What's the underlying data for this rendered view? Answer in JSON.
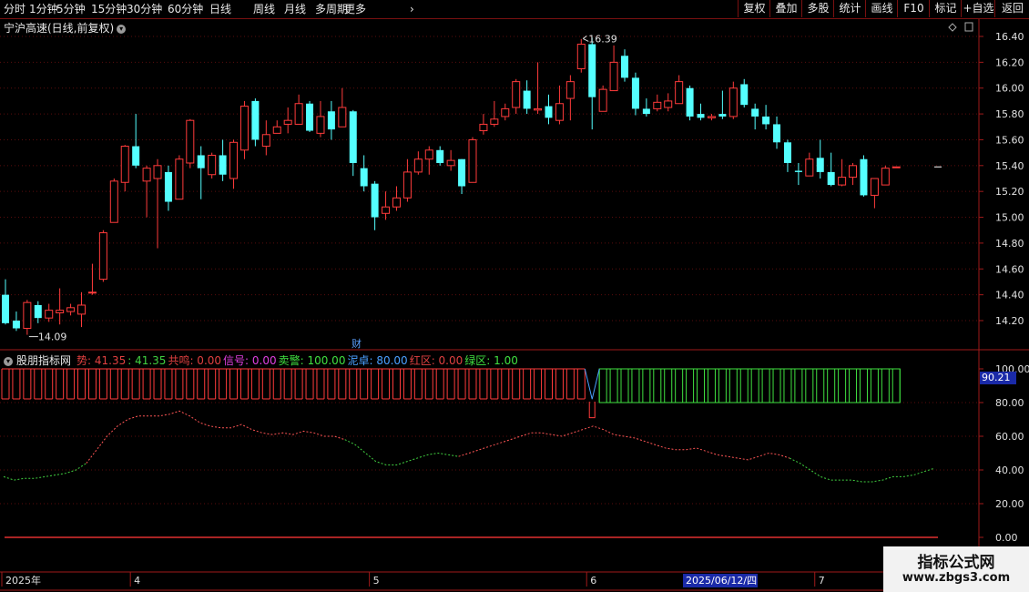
{
  "toolbar": {
    "periods": [
      "分时",
      "1分钟",
      "5分钟",
      "15分钟",
      "30分钟",
      "60分钟",
      "日线",
      "周线",
      "月线",
      "多周期",
      "更多"
    ],
    "active_period": "日线",
    "right_buttons": [
      "复权",
      "叠加",
      "多股",
      "统计",
      "画线",
      "F10",
      "标记",
      "+自选",
      "返回"
    ]
  },
  "stock": {
    "title": "宁沪高速(日线,前复权)",
    "high_label": "16.39",
    "low_label": "14.09"
  },
  "price_axis": {
    "ticks": [
      "16.40",
      "16.20",
      "16.00",
      "15.80",
      "15.60",
      "15.40",
      "15.20",
      "15.00",
      "14.80",
      "14.60",
      "14.40",
      "14.20"
    ]
  },
  "event_marker": "财",
  "indicator": {
    "name": "股朋指标网",
    "legend": [
      {
        "label": "势:",
        "value": "41.35",
        "color": "#e04040"
      },
      {
        "label": ":",
        "value": "41.35",
        "color": "#40d040"
      },
      {
        "label": "共鸣:",
        "value": "0.00",
        "color": "#e04040"
      },
      {
        "label": "信号:",
        "value": "0.00",
        "color": "#e040e0"
      },
      {
        "label": "卖警:",
        "value": "100.00",
        "color": "#40e040"
      },
      {
        "label": "泥卓:",
        "value": "80.00",
        "color": "#4aa0ff"
      },
      {
        "label": "红区:",
        "value": "0.00",
        "color": "#e04040"
      },
      {
        "label": "绿区:",
        "value": "1.00",
        "color": "#40e040"
      }
    ],
    "axis_ticks": [
      "100.00",
      "80.00",
      "60.00",
      "40.00",
      "20.00",
      "0.00"
    ],
    "current_value": "90.21"
  },
  "date_axis": {
    "labels": [
      {
        "text": "2025年",
        "i": 0
      },
      {
        "text": "4",
        "i": 12
      },
      {
        "text": "5",
        "i": 34
      },
      {
        "text": "6",
        "i": 54
      },
      {
        "text": "7",
        "i": 75
      }
    ],
    "cursor_date": "2025/06/12/四"
  },
  "watermark": {
    "line1": "指标公式网",
    "line2": "www.zbgs3.com"
  },
  "colors": {
    "up": "#ff3b3b",
    "down": "#54ffff",
    "grid": "#5a0d0d",
    "frame": "#a01a1a"
  },
  "chart_data": {
    "type": "candlestick",
    "ylim": [
      14.09,
      16.45
    ],
    "candles": [
      [
        14.4,
        14.18,
        14.52,
        14.17
      ],
      [
        14.2,
        14.14,
        14.27,
        14.12
      ],
      [
        14.14,
        14.34,
        14.36,
        14.09
      ],
      [
        14.32,
        14.22,
        14.35,
        14.18
      ],
      [
        14.22,
        14.28,
        14.33,
        14.19
      ],
      [
        14.26,
        14.28,
        14.45,
        14.17
      ],
      [
        14.27,
        14.3,
        14.33,
        14.24
      ],
      [
        14.25,
        14.32,
        14.42,
        14.15
      ],
      [
        14.42,
        14.42,
        14.64,
        14.4
      ],
      [
        14.52,
        14.88,
        14.9,
        14.5
      ],
      [
        14.96,
        15.28,
        15.3,
        14.96
      ],
      [
        15.27,
        15.55,
        15.56,
        15.2
      ],
      [
        15.55,
        15.4,
        15.8,
        15.38
      ],
      [
        15.28,
        15.38,
        15.4,
        15.0
      ],
      [
        15.3,
        15.4,
        15.45,
        14.76
      ],
      [
        15.35,
        15.12,
        15.4,
        15.05
      ],
      [
        15.14,
        15.45,
        15.48,
        15.14
      ],
      [
        15.42,
        15.75,
        15.76,
        15.38
      ],
      [
        15.48,
        15.38,
        15.55,
        15.14
      ],
      [
        15.33,
        15.48,
        15.5,
        15.3
      ],
      [
        15.48,
        15.33,
        15.6,
        15.28
      ],
      [
        15.3,
        15.58,
        15.6,
        15.22
      ],
      [
        15.52,
        15.86,
        15.9,
        15.45
      ],
      [
        15.9,
        15.6,
        15.92,
        15.55
      ],
      [
        15.55,
        15.64,
        15.75,
        15.48
      ],
      [
        15.65,
        15.7,
        15.75,
        15.68
      ],
      [
        15.72,
        15.75,
        15.85,
        15.65
      ],
      [
        15.72,
        15.88,
        15.95,
        15.72
      ],
      [
        15.88,
        15.67,
        15.9,
        15.66
      ],
      [
        15.65,
        15.78,
        15.9,
        15.62
      ],
      [
        15.82,
        15.68,
        15.9,
        15.6
      ],
      [
        15.7,
        15.85,
        16.0,
        15.7
      ],
      [
        15.82,
        15.42,
        15.83,
        15.32
      ],
      [
        15.38,
        15.24,
        15.48,
        15.2
      ],
      [
        15.26,
        15.0,
        15.28,
        14.9
      ],
      [
        15.03,
        15.08,
        15.2,
        14.98
      ],
      [
        15.08,
        15.15,
        15.24,
        15.05
      ],
      [
        15.15,
        15.35,
        15.45,
        15.12
      ],
      [
        15.35,
        15.45,
        15.51,
        15.33
      ],
      [
        15.45,
        15.52,
        15.55,
        15.33
      ],
      [
        15.52,
        15.42,
        15.55,
        15.4
      ],
      [
        15.4,
        15.44,
        15.52,
        15.36
      ],
      [
        15.45,
        15.24,
        15.45,
        15.18
      ],
      [
        15.27,
        15.6,
        15.62,
        15.27
      ],
      [
        15.67,
        15.72,
        15.8,
        15.64
      ],
      [
        15.72,
        15.76,
        15.9,
        15.7
      ],
      [
        15.78,
        15.84,
        15.88,
        15.75
      ],
      [
        15.85,
        16.05,
        16.07,
        15.8
      ],
      [
        15.98,
        15.84,
        16.06,
        15.8
      ],
      [
        15.83,
        15.84,
        16.2,
        15.8
      ],
      [
        15.86,
        15.77,
        15.95,
        15.72
      ],
      [
        15.75,
        15.88,
        16.02,
        15.72
      ],
      [
        15.92,
        16.05,
        16.1,
        15.75
      ],
      [
        16.15,
        16.34,
        16.38,
        16.12
      ],
      [
        16.34,
        15.93,
        16.39,
        15.68
      ],
      [
        15.82,
        15.99,
        16.02,
        15.82
      ],
      [
        15.98,
        16.2,
        16.33,
        15.98
      ],
      [
        16.25,
        16.08,
        16.3,
        16.05
      ],
      [
        16.08,
        15.84,
        16.12,
        15.79
      ],
      [
        15.84,
        15.8,
        15.92,
        15.78
      ],
      [
        15.84,
        15.89,
        15.95,
        15.82
      ],
      [
        15.85,
        15.9,
        15.96,
        15.82
      ],
      [
        15.88,
        16.05,
        16.1,
        15.88
      ],
      [
        16.0,
        15.78,
        16.02,
        15.75
      ],
      [
        15.8,
        15.77,
        15.88,
        15.75
      ],
      [
        15.77,
        15.78,
        15.8,
        15.75
      ],
      [
        15.8,
        15.78,
        15.98,
        15.76
      ],
      [
        15.78,
        16.0,
        16.05,
        15.76
      ],
      [
        16.03,
        15.87,
        16.07,
        15.85
      ],
      [
        15.84,
        15.78,
        15.88,
        15.68
      ],
      [
        15.78,
        15.72,
        15.87,
        15.68
      ],
      [
        15.72,
        15.58,
        15.78,
        15.53
      ],
      [
        15.58,
        15.42,
        15.6,
        15.35
      ],
      [
        15.36,
        15.35,
        15.42,
        15.25
      ],
      [
        15.32,
        15.45,
        15.5,
        15.32
      ],
      [
        15.46,
        15.35,
        15.6,
        15.3
      ],
      [
        15.35,
        15.25,
        15.5,
        15.24
      ],
      [
        15.25,
        15.31,
        15.45,
        15.24
      ],
      [
        15.31,
        15.4,
        15.42,
        15.25
      ],
      [
        15.45,
        15.17,
        15.48,
        15.16
      ],
      [
        15.17,
        15.3,
        15.3,
        15.07
      ],
      [
        15.25,
        15.38,
        15.4,
        15.25
      ],
      [
        15.39,
        15.39,
        15.39,
        15.39
      ]
    ],
    "signal_line": [
      36,
      34,
      35,
      35,
      36,
      37,
      38,
      40,
      44,
      52,
      60,
      66,
      70,
      72,
      72,
      72,
      73,
      75,
      72,
      68,
      66,
      65,
      65,
      67,
      64,
      62,
      61,
      62,
      61,
      63,
      62,
      60,
      60,
      58,
      55,
      50,
      45,
      43,
      43,
      45,
      47,
      49,
      50,
      49,
      48,
      50,
      52,
      54,
      56,
      58,
      60,
      62,
      62,
      61,
      60,
      62,
      64,
      66,
      64,
      61,
      60,
      59,
      57,
      55,
      53,
      52,
      52,
      53,
      51,
      49,
      48,
      47,
      46,
      48,
      50,
      49,
      47,
      44,
      40,
      36,
      34,
      34,
      34,
      33,
      33,
      34,
      36,
      36,
      37,
      39,
      41
    ],
    "signal_green_from": 33,
    "top_bar_split": 54,
    "top_bar_values": {
      "red": [
        80,
        100
      ],
      "green": [
        80,
        100
      ]
    },
    "indicator_ylim": [
      0,
      100
    ]
  }
}
